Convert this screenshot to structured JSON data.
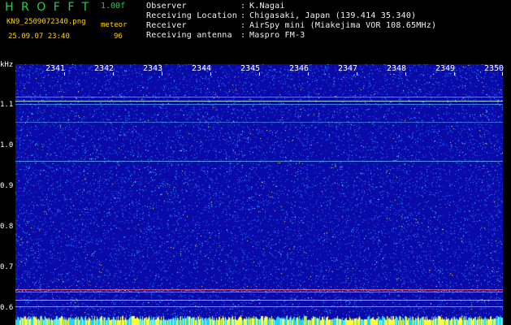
{
  "header": {
    "app_name": "HROFFT",
    "version": "1.00f",
    "file_name": "KN9_2509072340.png",
    "timestamp": "25.09.07 23:40",
    "meteor_label": "meteor",
    "meteor_count": "96",
    "info": [
      {
        "label": "Observer",
        "value": "K.Nagai"
      },
      {
        "label": "Receiving Location",
        "value": "Chigasaki, Japan (139.414 35.340)"
      },
      {
        "label": "Receiver",
        "value": "AirSpy mini (Miakejima VOR 108.65MHz)"
      },
      {
        "label": "Receiving antenna",
        "value": "Maspro FM-3"
      }
    ]
  },
  "spectrogram": {
    "freq_unit": "kHz",
    "time_ticks": [
      "2341",
      "2342",
      "2343",
      "2344",
      "2345",
      "2346",
      "2347",
      "2348",
      "2349",
      "2350"
    ],
    "freq_ticks": [
      "1.1",
      "1.0",
      "0.9",
      "0.8",
      "0.7",
      "0.6"
    ],
    "colors": {
      "background": "#0a0aa8",
      "noise_low": "#1e5cff",
      "noise_mid": "#22d3ff",
      "noise_high": "#ffff3a",
      "carrier": "#ff5050"
    }
  }
}
